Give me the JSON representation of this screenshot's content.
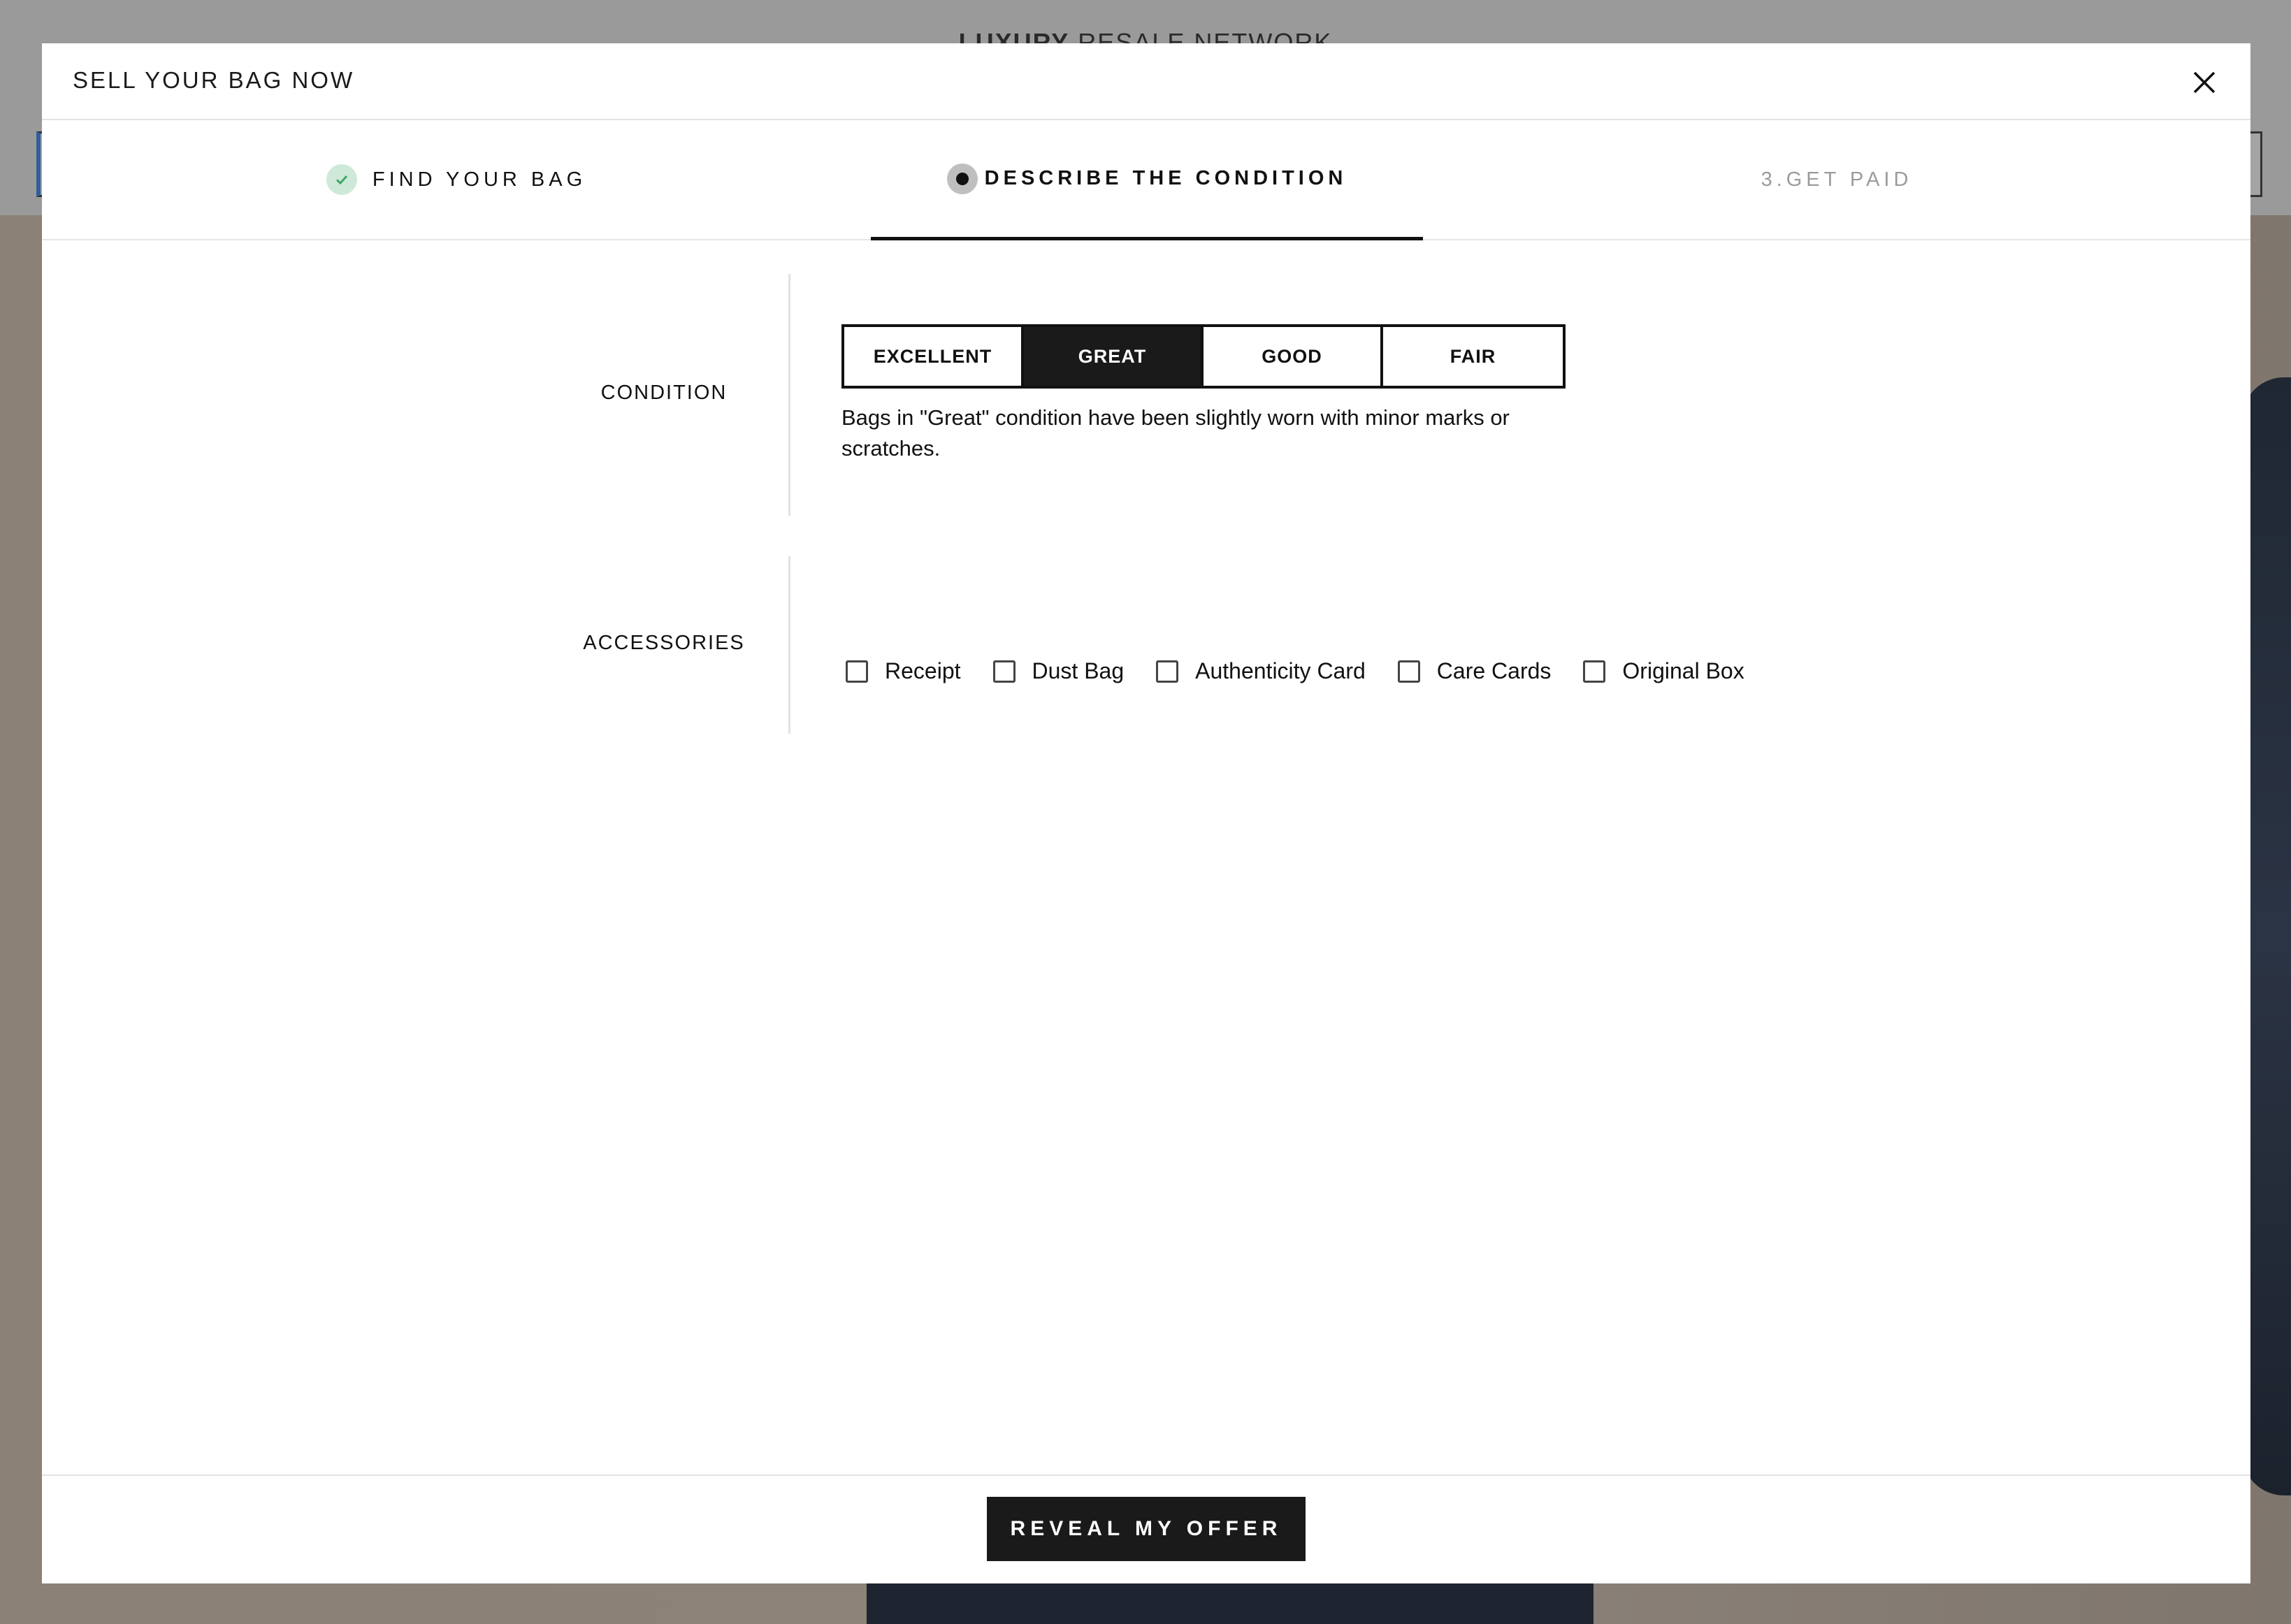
{
  "background": {
    "logo_bold": "LUXURY",
    "logo_rest": " RESALE NETWORK"
  },
  "modal": {
    "title": "SELL YOUR BAG NOW",
    "close_icon": "close-icon"
  },
  "steps": [
    {
      "label": "FIND YOUR BAG",
      "state": "completed",
      "icon": "check-icon"
    },
    {
      "label": "DESCRIBE THE CONDITION",
      "state": "active",
      "icon": "current-step-dot-icon"
    },
    {
      "label": "3.GET PAID",
      "state": "upcoming"
    }
  ],
  "condition": {
    "label": "CONDITION",
    "options": [
      "EXCELLENT",
      "GREAT",
      "GOOD",
      "FAIR"
    ],
    "selected": "GREAT",
    "description": "Bags in \"Great\" condition have been slightly worn with minor marks or scratches."
  },
  "accessories": {
    "label": "ACCESSORIES",
    "items": [
      {
        "label": "Receipt",
        "checked": false
      },
      {
        "label": "Dust Bag",
        "checked": false
      },
      {
        "label": "Authenticity Card",
        "checked": false
      },
      {
        "label": "Care Cards",
        "checked": false
      },
      {
        "label": "Original Box",
        "checked": false
      }
    ]
  },
  "footer": {
    "reveal_label": "REVEAL MY OFFER"
  },
  "colors": {
    "accent": "#1a1a1a",
    "completed_check": "#3fa86a",
    "completed_bg": "#cfe9d8",
    "upcoming_text": "#9b9b9b"
  }
}
